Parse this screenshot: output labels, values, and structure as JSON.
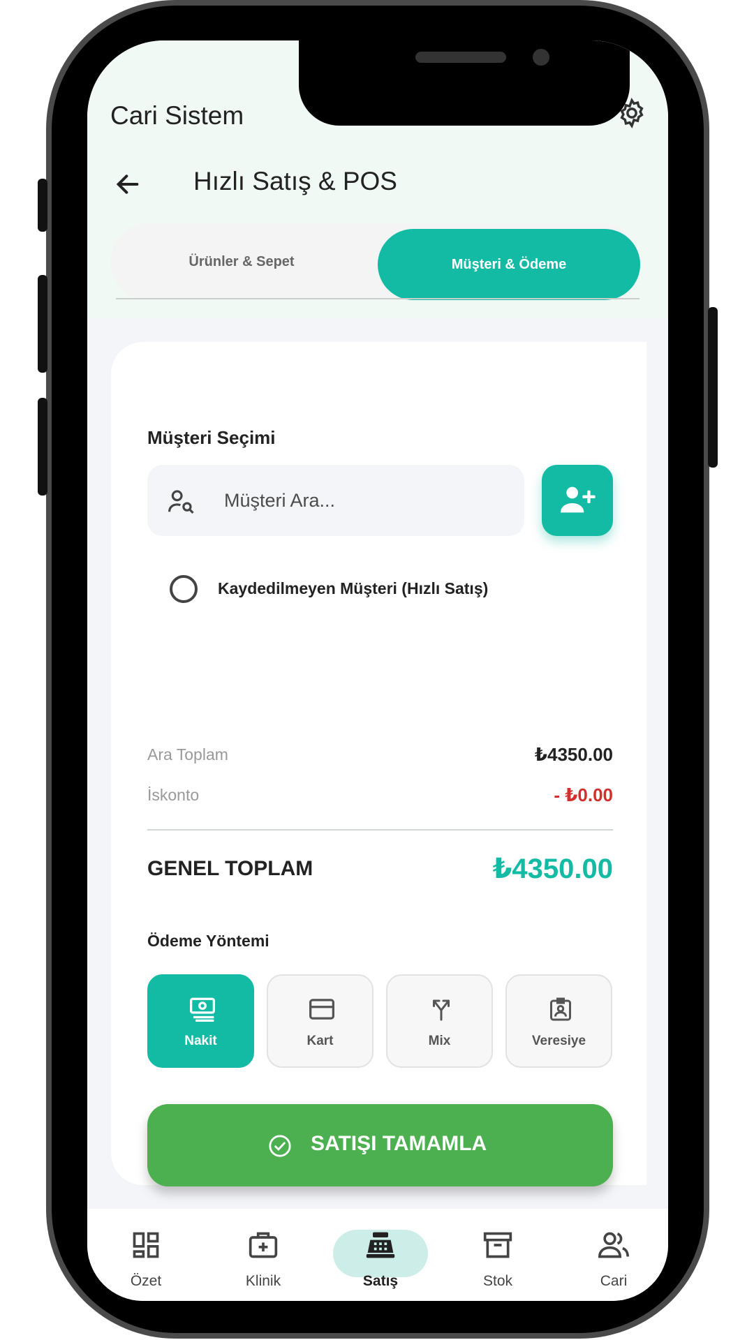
{
  "header": {
    "app_title": "Cari Sistem",
    "page_title": "Hızlı Satış & POS"
  },
  "tabs": [
    {
      "label": "Ürünler & Sepet",
      "active": false
    },
    {
      "label": "Müşteri & Ödeme",
      "active": true
    }
  ],
  "customer": {
    "section_title": "Müşteri Seçimi",
    "search_placeholder": "Müşteri Ara...",
    "unregistered_label": "Kaydedilmeyen Müşteri (Hızlı Satış)"
  },
  "summary": {
    "subtotal_label": "Ara Toplam",
    "subtotal_value": "₺4350.00",
    "discount_label": "İskonto",
    "discount_value": "- ₺0.00",
    "grand_label": "GENEL TOPLAM",
    "grand_value": "₺4350.00"
  },
  "payment": {
    "title": "Ödeme Yöntemi",
    "methods": [
      {
        "label": "Nakit",
        "icon": "cash-icon",
        "active": true
      },
      {
        "label": "Kart",
        "icon": "card-icon",
        "active": false
      },
      {
        "label": "Mix",
        "icon": "split-icon",
        "active": false
      },
      {
        "label": "Veresiye",
        "icon": "badge-icon",
        "active": false
      }
    ]
  },
  "complete_button": "SATIŞI TAMAMLA",
  "nav": [
    {
      "label": "Özet",
      "icon": "dashboard-icon",
      "active": false
    },
    {
      "label": "Klinik",
      "icon": "medical-kit-icon",
      "active": false
    },
    {
      "label": "Satış",
      "icon": "cash-register-icon",
      "active": true
    },
    {
      "label": "Stok",
      "icon": "archive-icon",
      "active": false
    },
    {
      "label": "Cari",
      "icon": "group-icon",
      "active": false
    }
  ],
  "colors": {
    "accent": "#14bba4",
    "success": "#4caf50",
    "danger": "#d32f2f",
    "header_bg": "#f1f9f5"
  }
}
